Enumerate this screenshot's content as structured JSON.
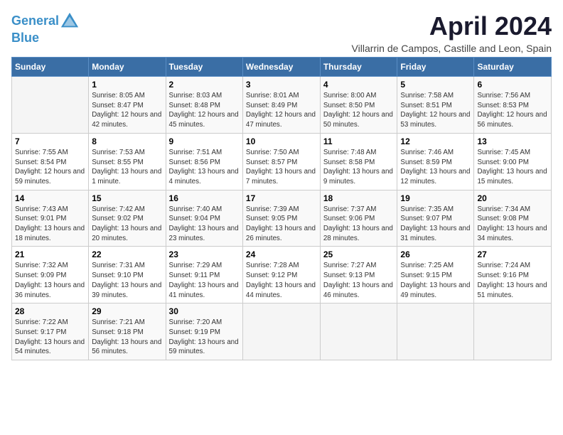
{
  "header": {
    "logo_line1": "General",
    "logo_line2": "Blue",
    "month_title": "April 2024",
    "subtitle": "Villarrin de Campos, Castille and Leon, Spain"
  },
  "days_of_week": [
    "Sunday",
    "Monday",
    "Tuesday",
    "Wednesday",
    "Thursday",
    "Friday",
    "Saturday"
  ],
  "weeks": [
    [
      {
        "num": "",
        "empty": true
      },
      {
        "num": "1",
        "sunrise": "Sunrise: 8:05 AM",
        "sunset": "Sunset: 8:47 PM",
        "daylight": "Daylight: 12 hours and 42 minutes."
      },
      {
        "num": "2",
        "sunrise": "Sunrise: 8:03 AM",
        "sunset": "Sunset: 8:48 PM",
        "daylight": "Daylight: 12 hours and 45 minutes."
      },
      {
        "num": "3",
        "sunrise": "Sunrise: 8:01 AM",
        "sunset": "Sunset: 8:49 PM",
        "daylight": "Daylight: 12 hours and 47 minutes."
      },
      {
        "num": "4",
        "sunrise": "Sunrise: 8:00 AM",
        "sunset": "Sunset: 8:50 PM",
        "daylight": "Daylight: 12 hours and 50 minutes."
      },
      {
        "num": "5",
        "sunrise": "Sunrise: 7:58 AM",
        "sunset": "Sunset: 8:51 PM",
        "daylight": "Daylight: 12 hours and 53 minutes."
      },
      {
        "num": "6",
        "sunrise": "Sunrise: 7:56 AM",
        "sunset": "Sunset: 8:53 PM",
        "daylight": "Daylight: 12 hours and 56 minutes."
      }
    ],
    [
      {
        "num": "7",
        "sunrise": "Sunrise: 7:55 AM",
        "sunset": "Sunset: 8:54 PM",
        "daylight": "Daylight: 12 hours and 59 minutes."
      },
      {
        "num": "8",
        "sunrise": "Sunrise: 7:53 AM",
        "sunset": "Sunset: 8:55 PM",
        "daylight": "Daylight: 13 hours and 1 minute."
      },
      {
        "num": "9",
        "sunrise": "Sunrise: 7:51 AM",
        "sunset": "Sunset: 8:56 PM",
        "daylight": "Daylight: 13 hours and 4 minutes."
      },
      {
        "num": "10",
        "sunrise": "Sunrise: 7:50 AM",
        "sunset": "Sunset: 8:57 PM",
        "daylight": "Daylight: 13 hours and 7 minutes."
      },
      {
        "num": "11",
        "sunrise": "Sunrise: 7:48 AM",
        "sunset": "Sunset: 8:58 PM",
        "daylight": "Daylight: 13 hours and 9 minutes."
      },
      {
        "num": "12",
        "sunrise": "Sunrise: 7:46 AM",
        "sunset": "Sunset: 8:59 PM",
        "daylight": "Daylight: 13 hours and 12 minutes."
      },
      {
        "num": "13",
        "sunrise": "Sunrise: 7:45 AM",
        "sunset": "Sunset: 9:00 PM",
        "daylight": "Daylight: 13 hours and 15 minutes."
      }
    ],
    [
      {
        "num": "14",
        "sunrise": "Sunrise: 7:43 AM",
        "sunset": "Sunset: 9:01 PM",
        "daylight": "Daylight: 13 hours and 18 minutes."
      },
      {
        "num": "15",
        "sunrise": "Sunrise: 7:42 AM",
        "sunset": "Sunset: 9:02 PM",
        "daylight": "Daylight: 13 hours and 20 minutes."
      },
      {
        "num": "16",
        "sunrise": "Sunrise: 7:40 AM",
        "sunset": "Sunset: 9:04 PM",
        "daylight": "Daylight: 13 hours and 23 minutes."
      },
      {
        "num": "17",
        "sunrise": "Sunrise: 7:39 AM",
        "sunset": "Sunset: 9:05 PM",
        "daylight": "Daylight: 13 hours and 26 minutes."
      },
      {
        "num": "18",
        "sunrise": "Sunrise: 7:37 AM",
        "sunset": "Sunset: 9:06 PM",
        "daylight": "Daylight: 13 hours and 28 minutes."
      },
      {
        "num": "19",
        "sunrise": "Sunrise: 7:35 AM",
        "sunset": "Sunset: 9:07 PM",
        "daylight": "Daylight: 13 hours and 31 minutes."
      },
      {
        "num": "20",
        "sunrise": "Sunrise: 7:34 AM",
        "sunset": "Sunset: 9:08 PM",
        "daylight": "Daylight: 13 hours and 34 minutes."
      }
    ],
    [
      {
        "num": "21",
        "sunrise": "Sunrise: 7:32 AM",
        "sunset": "Sunset: 9:09 PM",
        "daylight": "Daylight: 13 hours and 36 minutes."
      },
      {
        "num": "22",
        "sunrise": "Sunrise: 7:31 AM",
        "sunset": "Sunset: 9:10 PM",
        "daylight": "Daylight: 13 hours and 39 minutes."
      },
      {
        "num": "23",
        "sunrise": "Sunrise: 7:29 AM",
        "sunset": "Sunset: 9:11 PM",
        "daylight": "Daylight: 13 hours and 41 minutes."
      },
      {
        "num": "24",
        "sunrise": "Sunrise: 7:28 AM",
        "sunset": "Sunset: 9:12 PM",
        "daylight": "Daylight: 13 hours and 44 minutes."
      },
      {
        "num": "25",
        "sunrise": "Sunrise: 7:27 AM",
        "sunset": "Sunset: 9:13 PM",
        "daylight": "Daylight: 13 hours and 46 minutes."
      },
      {
        "num": "26",
        "sunrise": "Sunrise: 7:25 AM",
        "sunset": "Sunset: 9:15 PM",
        "daylight": "Daylight: 13 hours and 49 minutes."
      },
      {
        "num": "27",
        "sunrise": "Sunrise: 7:24 AM",
        "sunset": "Sunset: 9:16 PM",
        "daylight": "Daylight: 13 hours and 51 minutes."
      }
    ],
    [
      {
        "num": "28",
        "sunrise": "Sunrise: 7:22 AM",
        "sunset": "Sunset: 9:17 PM",
        "daylight": "Daylight: 13 hours and 54 minutes."
      },
      {
        "num": "29",
        "sunrise": "Sunrise: 7:21 AM",
        "sunset": "Sunset: 9:18 PM",
        "daylight": "Daylight: 13 hours and 56 minutes."
      },
      {
        "num": "30",
        "sunrise": "Sunrise: 7:20 AM",
        "sunset": "Sunset: 9:19 PM",
        "daylight": "Daylight: 13 hours and 59 minutes."
      },
      {
        "num": "",
        "empty": true
      },
      {
        "num": "",
        "empty": true
      },
      {
        "num": "",
        "empty": true
      },
      {
        "num": "",
        "empty": true
      }
    ]
  ]
}
